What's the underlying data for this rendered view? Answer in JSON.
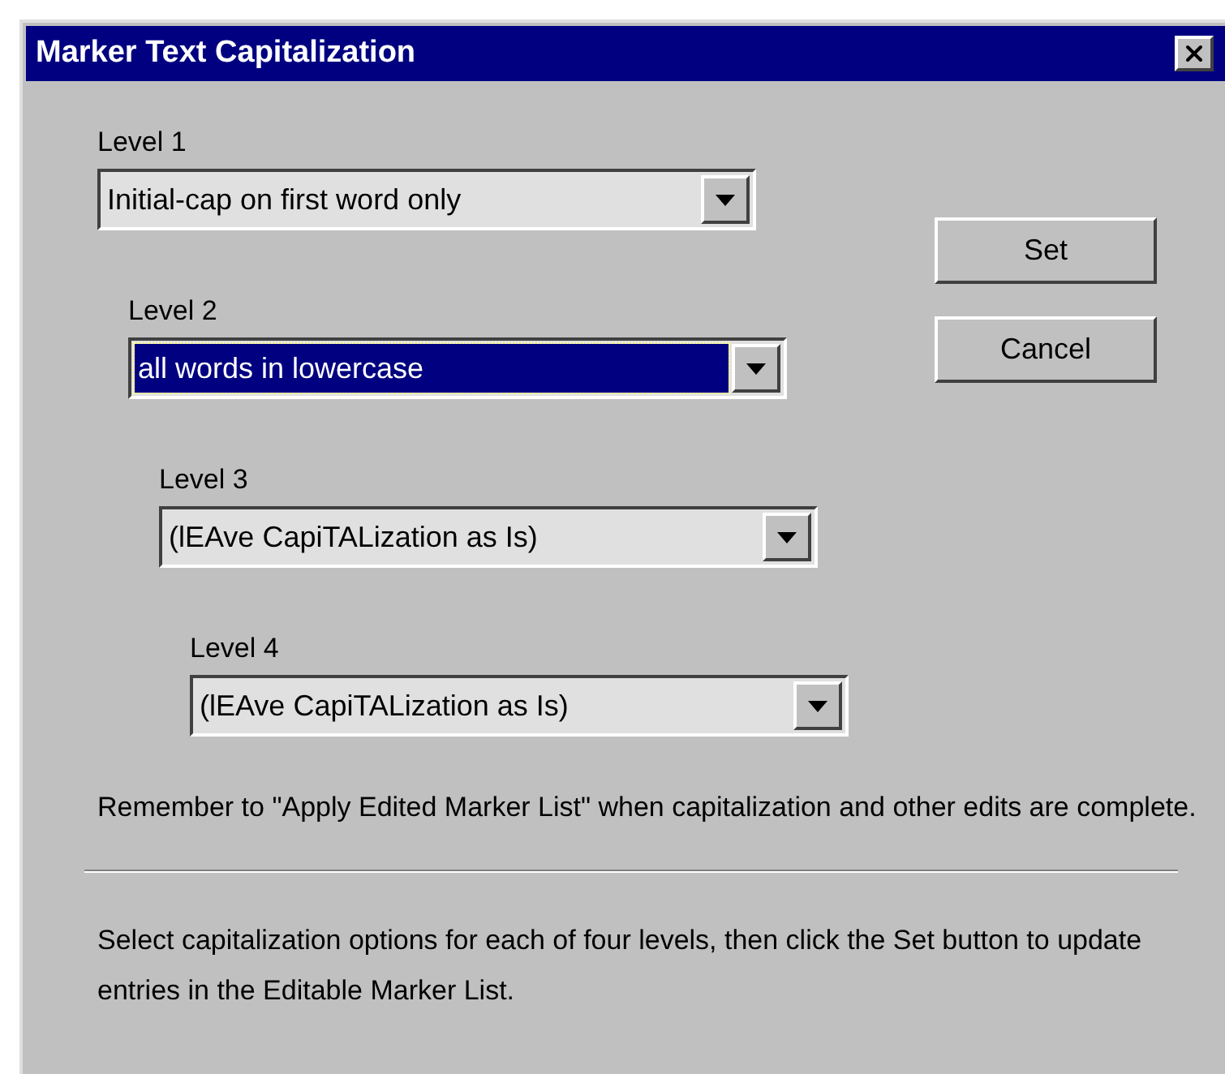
{
  "window": {
    "title": "Marker Text Capitalization"
  },
  "levels": [
    {
      "label": "Level 1",
      "value": "Initial-cap on first word only",
      "focused": false
    },
    {
      "label": "Level 2",
      "value": "all words in lowercase",
      "focused": true
    },
    {
      "label": "Level 3",
      "value": "(lEAve CapiTALization as Is)",
      "focused": false
    },
    {
      "label": "Level 4",
      "value": "(lEAve CapiTALization as Is)",
      "focused": false
    }
  ],
  "buttons": [
    "Set",
    "Cancel"
  ],
  "reminder": "Remember to \"Apply Edited Marker List\" when capitalization and other edits are complete.",
  "help": "Select capitalization options for each of four levels, then click the Set button to update entries in the Editable Marker List."
}
